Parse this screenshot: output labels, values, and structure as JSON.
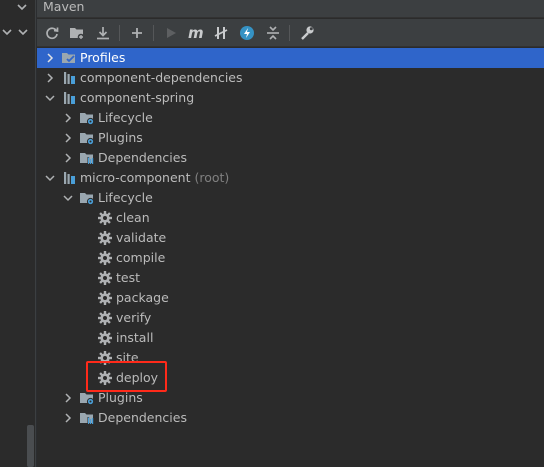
{
  "panel": {
    "title": "Maven"
  },
  "toolbar": {
    "buttons": [
      {
        "name": "reload-icon"
      },
      {
        "name": "add-folder-icon"
      },
      {
        "name": "download-icon"
      },
      {
        "name": "plus-icon"
      },
      {
        "name": "run-icon"
      },
      {
        "name": "execute-goal-icon",
        "glyph": "m"
      },
      {
        "name": "toggle-offline-icon"
      },
      {
        "name": "skip-tests-icon"
      },
      {
        "name": "collapse-all-icon"
      },
      {
        "name": "settings-wrench-icon"
      }
    ]
  },
  "tree": {
    "profiles": "Profiles",
    "component_dependencies": "component-dependencies",
    "component_spring": "component-spring",
    "cs_lifecycle": "Lifecycle",
    "cs_plugins": "Plugins",
    "cs_dependencies": "Dependencies",
    "micro_component": "micro-component",
    "micro_component_suffix": "(root)",
    "mc_lifecycle": "Lifecycle",
    "goals": [
      "clean",
      "validate",
      "compile",
      "test",
      "package",
      "verify",
      "install",
      "site",
      "deploy"
    ],
    "mc_plugins": "Plugins",
    "mc_dependencies": "Dependencies"
  },
  "colors": {
    "selection": "#2f65ca",
    "highlight_box": "#ff2a1a",
    "maven_blue": "#4a9fd8"
  }
}
